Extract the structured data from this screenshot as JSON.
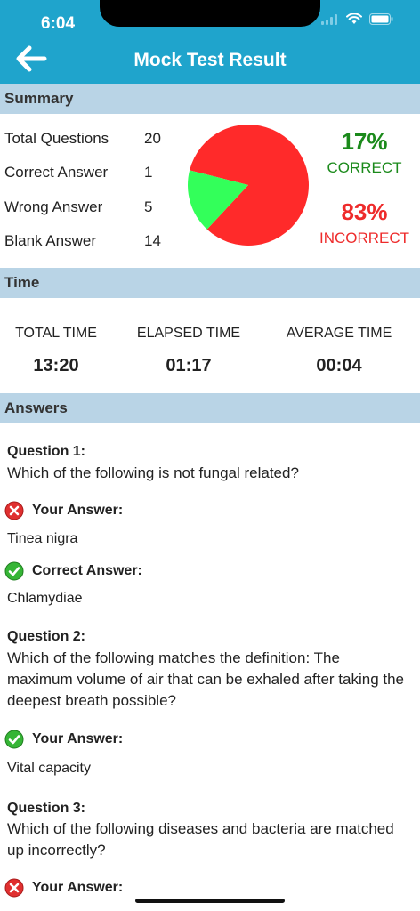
{
  "status": {
    "time": "6:04"
  },
  "header": {
    "title": "Mock Test Result"
  },
  "summary": {
    "section_title": "Summary",
    "rows": [
      {
        "label": "Total Questions",
        "value": "20"
      },
      {
        "label": "Correct Answer",
        "value": "1"
      },
      {
        "label": "Wrong Answer",
        "value": "5"
      },
      {
        "label": "Blank Answer",
        "value": "14"
      }
    ],
    "correct_pct": "17%",
    "correct_label": "CORRECT",
    "incorrect_pct": "83%",
    "incorrect_label": "INCORRECT",
    "pie": {
      "correct_fraction": 0.17,
      "correct_color": "#33ff5a",
      "incorrect_color": "#ff2a2a"
    }
  },
  "time": {
    "section_title": "Time",
    "total_label": "TOTAL TIME",
    "total_value": "13:20",
    "elapsed_label": "ELAPSED TIME",
    "elapsed_value": "01:17",
    "average_label": "AVERAGE TIME",
    "average_value": "00:04"
  },
  "answers": {
    "section_title": "Answers",
    "q1": {
      "heading": "Question 1:",
      "text": "Which of the following is not fungal related?",
      "your_label": "Your Answer:",
      "your_answer": "Tinea nigra",
      "correct_label": "Correct Answer:",
      "correct_answer": "Chlamydiae"
    },
    "q2": {
      "heading": "Question 2:",
      "text": "Which of the following matches the definition: The maximum volume of air that can be exhaled after taking the deepest breath possible?",
      "your_label": "Your Answer:",
      "your_answer": "Vital capacity"
    },
    "q3": {
      "heading": "Question 3:",
      "text": "Which of the following diseases and bacteria are matched up incorrectly?",
      "your_label": "Your Answer:"
    }
  }
}
